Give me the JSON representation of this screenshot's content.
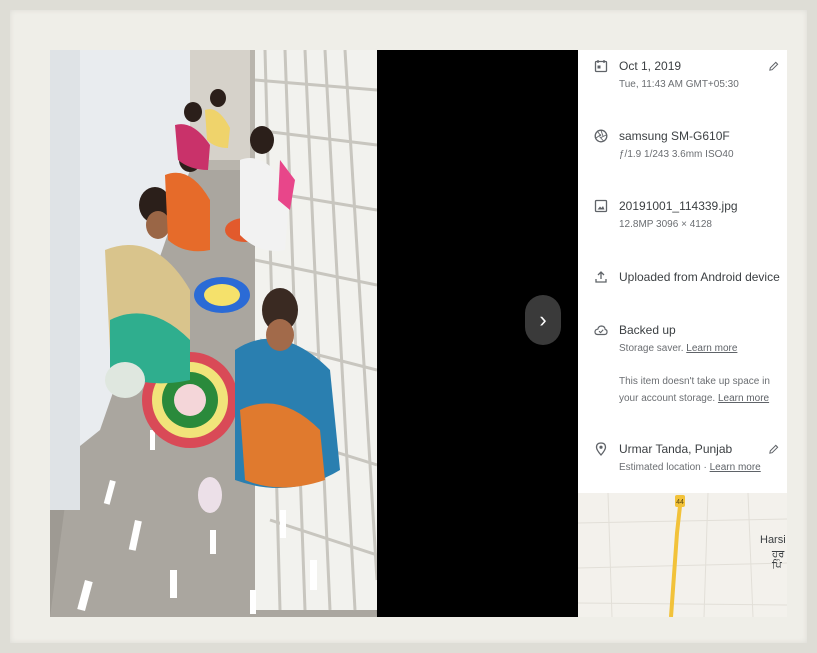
{
  "details": {
    "date": {
      "title": "Oct 1, 2019",
      "sub": "Tue, 11:43 AM   GMT+05:30"
    },
    "camera": {
      "title": "samsung SM-G610F",
      "sub": "ƒ/1.9   1/243   3.6mm   ISO40"
    },
    "file": {
      "title": "20191001_114339.jpg",
      "sub": "12.8MP   3096 × 4128"
    },
    "upload": {
      "title": "Uploaded from Android device"
    },
    "backup": {
      "title": "Backed up",
      "sub_prefix": "Storage saver.",
      "sub_link": "Learn more",
      "note": "This item doesn't take up space in your account storage.",
      "note_link": "Learn more"
    },
    "location": {
      "title": "Urmar Tanda, Punjab",
      "sub_prefix": "Estimated location ·",
      "sub_link": "Learn more"
    }
  },
  "map": {
    "place": "Harsi",
    "place_local_1": "ਹਰ",
    "place_local_2": "ਪਿੰ",
    "road_badge": "44"
  },
  "navigation": {
    "next_glyph": "›"
  },
  "colors": {
    "panel_bg": "#ffffff",
    "viewer_bg": "#000000",
    "road": "#f2c23a"
  }
}
